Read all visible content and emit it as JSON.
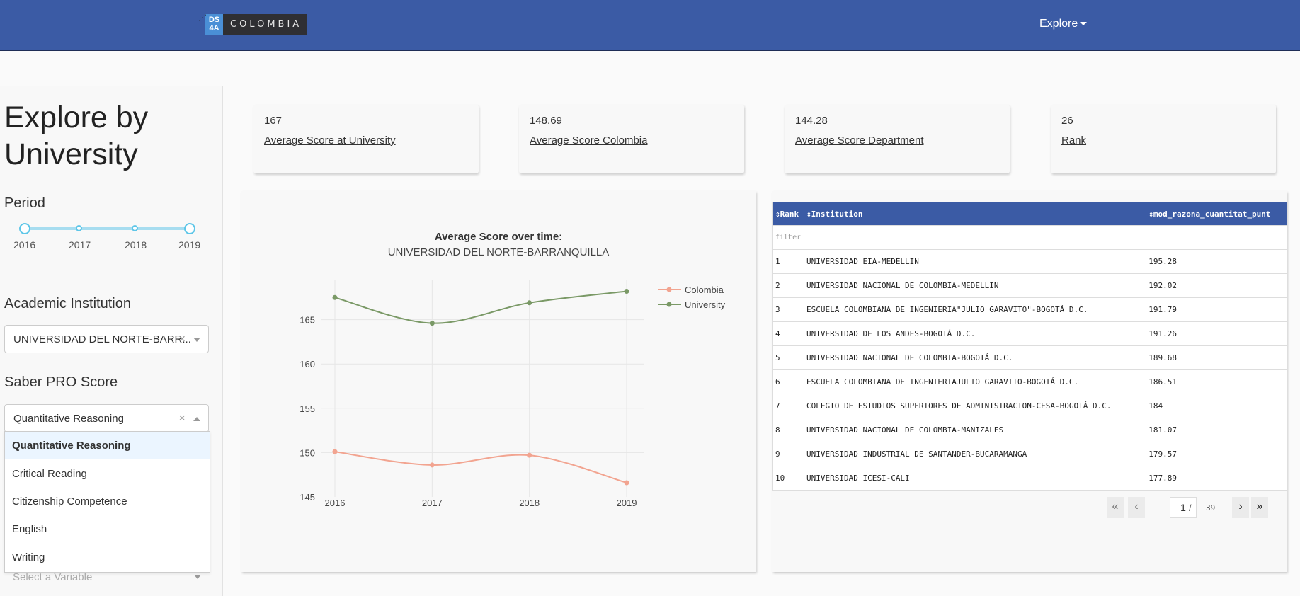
{
  "header": {
    "logo_ds": "DS\n4A",
    "logo_word": "COLOMBIA",
    "nav_explore": "Explore"
  },
  "sidebar": {
    "title": "Explore by University",
    "period_label": "Period",
    "period_years": [
      "2016",
      "2017",
      "2018",
      "2019"
    ],
    "institution_label": "Academic Institution",
    "institution_value": "UNIVERSIDAD DEL NORTE-BARR...",
    "score_label": "Saber PRO Score",
    "score_value": "Quantitative Reasoning",
    "score_options": [
      "Quantitative Reasoning",
      "Critical Reading",
      "Citizenship Competence",
      "English",
      "Writing"
    ],
    "variable_placeholder": "Select a Variable"
  },
  "cards": [
    {
      "value": "167",
      "label": "Average Score at University"
    },
    {
      "value": "148.69",
      "label": "Average Score Colombia"
    },
    {
      "value": "144.28",
      "label": "Average Score Department"
    },
    {
      "value": "26",
      "label": "Rank"
    }
  ],
  "chart_data": {
    "type": "line",
    "title": "Average Score over time:",
    "subtitle": "UNIVERSIDAD DEL NORTE-BARRANQUILLA",
    "x": [
      "2016",
      "2017",
      "2018",
      "2019"
    ],
    "series": [
      {
        "name": "Colombia",
        "color": "#f2a490",
        "values": [
          150.1,
          148.6,
          149.7,
          146.6
        ]
      },
      {
        "name": "University",
        "color": "#7a9966",
        "values": [
          167.5,
          164.6,
          166.9,
          168.2
        ]
      }
    ],
    "ylim": [
      145,
      170
    ],
    "yticks": [
      145,
      150,
      155,
      160,
      165
    ],
    "legend": "top-right",
    "grid": true
  },
  "table": {
    "columns": [
      "Rank",
      "Institution",
      "mod_razona_cuantitat_punt"
    ],
    "filter_placeholder": "filter data...",
    "rows": [
      [
        "1",
        "UNIVERSIDAD EIA-MEDELLIN",
        "195.28"
      ],
      [
        "2",
        "UNIVERSIDAD NACIONAL DE COLOMBIA-MEDELLIN",
        "192.02"
      ],
      [
        "3",
        "ESCUELA COLOMBIANA DE INGENIERIA\"JULIO GARAVITO\"-BOGOTÁ D.C.",
        "191.79"
      ],
      [
        "4",
        "UNIVERSIDAD DE LOS ANDES-BOGOTÁ D.C.",
        "191.26"
      ],
      [
        "5",
        "UNIVERSIDAD NACIONAL DE COLOMBIA-BOGOTÁ D.C.",
        "189.68"
      ],
      [
        "6",
        "ESCUELA COLOMBIANA DE INGENIERIAJULIO GARAVITO-BOGOTÁ D.C.",
        "186.51"
      ],
      [
        "7",
        "COLEGIO DE ESTUDIOS SUPERIORES DE ADMINISTRACION-CESA-BOGOTÁ D.C.",
        "184"
      ],
      [
        "8",
        "UNIVERSIDAD NACIONAL DE COLOMBIA-MANIZALES",
        "181.07"
      ],
      [
        "9",
        "UNIVERSIDAD INDUSTRIAL DE SANTANDER-BUCARAMANGA",
        "179.57"
      ],
      [
        "10",
        "UNIVERSIDAD ICESI-CALI",
        "177.89"
      ]
    ],
    "page_current": "1",
    "page_sep": "/",
    "page_total": "39"
  }
}
